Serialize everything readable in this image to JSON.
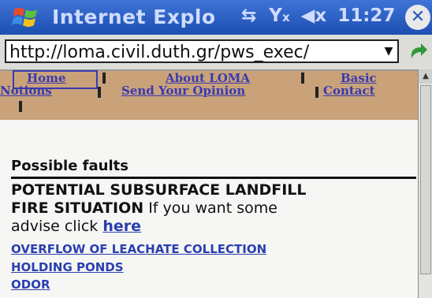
{
  "titlebar": {
    "title": "Internet Explo",
    "time": "11:27",
    "icons": [
      "windows-start-icon",
      "connectivity-icon",
      "signal-icon",
      "volume-muted-icon",
      "close-icon"
    ],
    "close_glyph": "✕",
    "colors": {
      "bar": "#2a5cc4",
      "text": "#cfdcff"
    }
  },
  "addressbar": {
    "url": "http://loma.civil.duth.gr/pws_exec/",
    "dropdown_glyph": "▼"
  },
  "nav": {
    "home": "Home",
    "about": "About LOMA",
    "basic_notions_1": "Basic",
    "basic_notions_2": "Notions",
    "send_opinion": "Send Your Opinion",
    "contact": "Contact",
    "colors": {
      "bg": "#c9a27a",
      "link": "#3a3ab0"
    }
  },
  "main": {
    "section_title": "Possible faults",
    "fault1_bold_1": "POTENTIAL SUBSURFACE LANDFILL",
    "fault1_bold_2": "FIRE SITUATION",
    "fault1_text": " If you want some",
    "fault1_text_2": "advise click ",
    "here_link": "here",
    "fault2_line1": "OVERFLOW OF LEACHATE COLLECTION",
    "fault2_line2": "HOLDING PONDS",
    "fault3": "ODOR"
  }
}
